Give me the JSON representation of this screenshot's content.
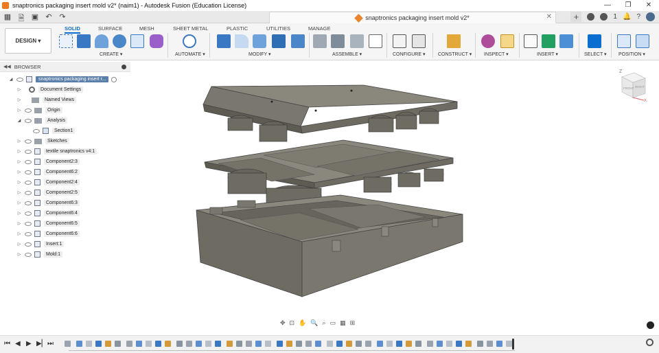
{
  "window": {
    "title": "snaptronics packaging insert mold v2* (naim1) - Autodesk Fusion (Education License)",
    "controls": [
      "—",
      "❐",
      "✕"
    ]
  },
  "document_tab": {
    "title": "snaptronics packaging insert mold v2*",
    "notif_count": "1"
  },
  "workspace": {
    "label": "DESIGN ▾"
  },
  "ribbon": {
    "tabs": [
      "SOLID",
      "SURFACE",
      "MESH",
      "SHEET METAL",
      "PLASTIC",
      "UTILITIES",
      "MANAGE"
    ],
    "active_tab": "SOLID",
    "groups": [
      "CREATE ▾",
      "AUTOMATE ▾",
      "MODIFY ▾",
      "ASSEMBLE ▾",
      "CONFIGURE ▾",
      "CONSTRUCT ▾",
      "INSPECT ▾",
      "INSERT ▾",
      "SELECT ▾",
      "POSITION ▾"
    ]
  },
  "browser": {
    "title": "BROWSER",
    "root": "snaptronics packaging insert r...",
    "items": [
      {
        "label": "Document Settings",
        "icon": "gear-icon",
        "eye": false
      },
      {
        "label": "Named Views",
        "icon": "folder-icon",
        "eye": false
      },
      {
        "label": "Origin",
        "icon": "folder-icon",
        "eye": true
      },
      {
        "label": "Analysis",
        "icon": "folder-icon",
        "eye": true
      },
      {
        "label": "Section1",
        "icon": "section-icon",
        "eye": true
      },
      {
        "label": "Sketches",
        "icon": "folder-icon",
        "eye": true
      },
      {
        "label": "textile snaptronics v4:1",
        "icon": "component-icon",
        "eye": true
      },
      {
        "label": "Component2:3",
        "icon": "component-icon",
        "eye": true
      },
      {
        "label": "Component6:2",
        "icon": "component-icon",
        "eye": true
      },
      {
        "label": "Component2:4",
        "icon": "component-icon",
        "eye": true
      },
      {
        "label": "Component2:5",
        "icon": "component-icon",
        "eye": true
      },
      {
        "label": "Component6:3",
        "icon": "component-icon",
        "eye": true
      },
      {
        "label": "Component6:4",
        "icon": "component-icon",
        "eye": true
      },
      {
        "label": "Component6:5",
        "icon": "component-icon",
        "eye": true
      },
      {
        "label": "Component6:6",
        "icon": "component-icon",
        "eye": true
      },
      {
        "label": "Insert:1",
        "icon": "component-icon",
        "eye": true
      },
      {
        "label": "Mold:1",
        "icon": "component-icon",
        "eye": true
      }
    ]
  },
  "viewcube": {
    "faces": [
      "FRONT",
      "RIGHT"
    ],
    "axis_z": "Z",
    "axis_x": "X"
  },
  "colors": {
    "accent": "#0a6ed1",
    "model": "#6e6b62",
    "model_top": "#8a877d"
  }
}
